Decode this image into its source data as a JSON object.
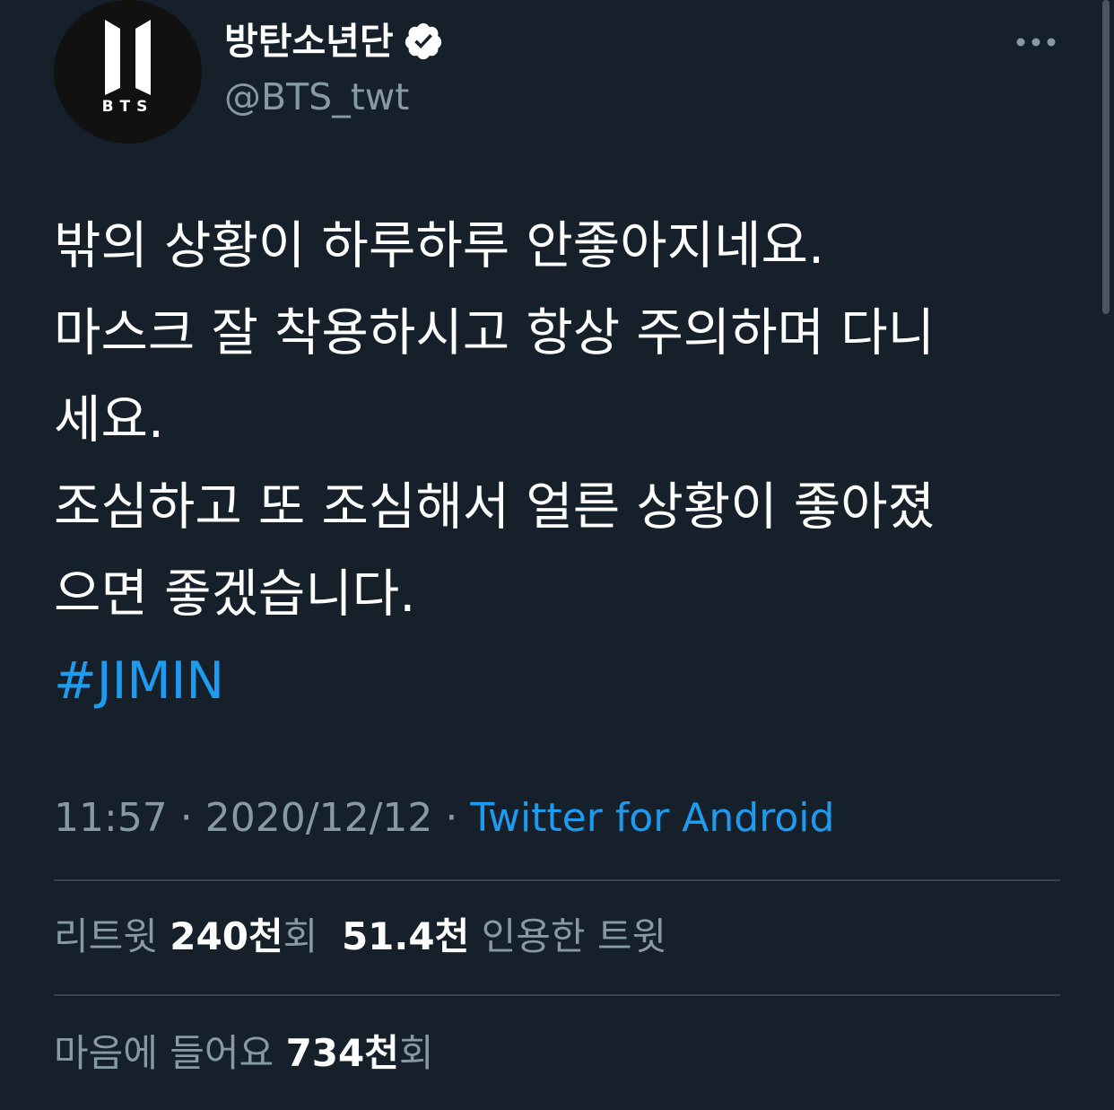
{
  "account": {
    "display_name": "방탄소년단",
    "handle": "@BTS_twt",
    "avatar_text": "BTS",
    "verified": true
  },
  "tweet": {
    "lines": [
      "밖의 상황이 하루하루 안좋아지네요.",
      "마스크 잘 착용하시고 항상 주의하며 다니",
      "세요.",
      "조심하고 또 조심해서 얼른 상황이 좋아졌",
      "으면 좋겠습니다."
    ],
    "hashtag": "#JIMIN"
  },
  "meta": {
    "time": "11:57",
    "separator": " · ",
    "date": "2020/12/12",
    "source": "Twitter for Android"
  },
  "stats": {
    "retweets_label": "리트윗",
    "retweets_value": "240천",
    "retweets_suffix": "회",
    "quotes_value": "51.4천",
    "quotes_label": "인용한 트윗",
    "likes_label": "마음에 들어요",
    "likes_value": "734천",
    "likes_suffix": "회"
  },
  "colors": {
    "background": "#15202b",
    "secondary_text": "#8899a6",
    "accent": "#1d9bf0",
    "divider": "#38444d"
  },
  "icons": {
    "verified": "verified-badge-icon",
    "more": "more-horizontal-icon"
  }
}
